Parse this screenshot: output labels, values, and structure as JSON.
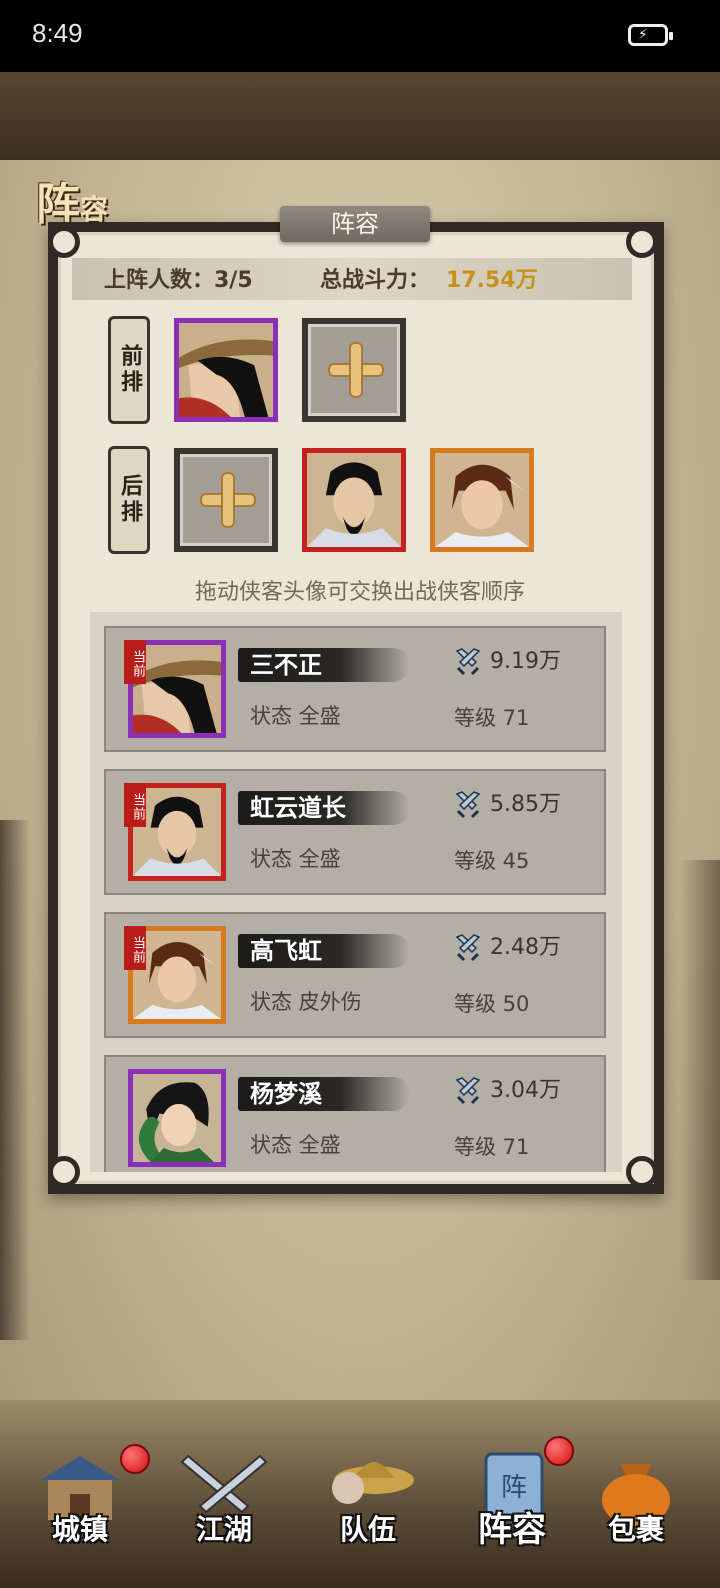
{
  "status_bar": {
    "time": "8:49",
    "battery_icon": "battery-charging-icon"
  },
  "page_title": {
    "big": "阵",
    "small": "容"
  },
  "panel": {
    "title": "阵容"
  },
  "summary": {
    "count_label": "上阵人数：3/5",
    "power_label": "总战斗力：",
    "power_value": "17.54万",
    "power_color": "#c59318"
  },
  "formation": {
    "front_label": "前排",
    "back_label": "后排",
    "front_slots": [
      {
        "state": "filled",
        "hero": "三不正",
        "frame": "purple"
      },
      {
        "state": "empty",
        "icon": "plus-icon"
      }
    ],
    "back_slots": [
      {
        "state": "empty",
        "icon": "plus-icon"
      },
      {
        "state": "filled",
        "hero": "虹云道长",
        "frame": "red"
      },
      {
        "state": "filled",
        "hero": "高飞虹",
        "frame": "orange"
      }
    ]
  },
  "hint": "拖动侠客头像可交换出战侠客顺序",
  "heroes": [
    {
      "badge": "当前",
      "name": "三不正",
      "state": "状态 全盛",
      "power": "9.19万",
      "level": "等级 71",
      "frame": "purple"
    },
    {
      "badge": "当前",
      "name": "虹云道长",
      "state": "状态 全盛",
      "power": "5.85万",
      "level": "等级 45",
      "frame": "red"
    },
    {
      "badge": "当前",
      "name": "高飞虹",
      "state": "状态 皮外伤",
      "power": "2.48万",
      "level": "等级 50",
      "frame": "orange"
    },
    {
      "badge": "",
      "name": "杨梦溪",
      "state": "状态 全盛",
      "power": "3.04万",
      "level": "等级 71",
      "frame": "purple"
    }
  ],
  "nav": [
    {
      "label": "城镇",
      "icon": "town-icon",
      "dot": true
    },
    {
      "label": "江湖",
      "icon": "crossed-swords-icon",
      "dot": false
    },
    {
      "label": "队伍",
      "icon": "straw-hat-icon",
      "dot": false
    },
    {
      "label": "阵容",
      "icon": "formation-scroll-icon",
      "dot": true,
      "active": true
    },
    {
      "label": "包裹",
      "icon": "bag-icon",
      "dot": false
    }
  ]
}
